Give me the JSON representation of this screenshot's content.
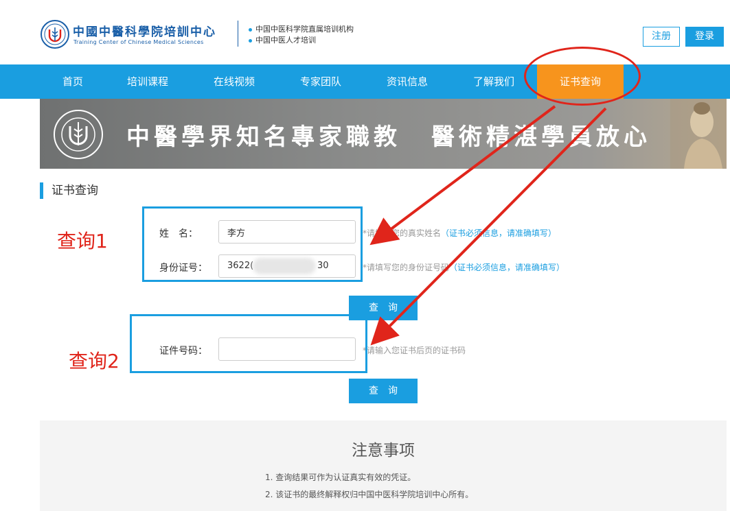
{
  "header": {
    "logo_cn": "中國中醫科學院培訓中心",
    "logo_en": "Training Center of Chinese Medical Sciences",
    "taglines": [
      "中国中医科学院直属培训机构",
      "中国中医人才培训"
    ],
    "register_label": "注册",
    "login_label": "登录"
  },
  "nav": {
    "items": [
      {
        "label": "首页"
      },
      {
        "label": "培训课程"
      },
      {
        "label": "在线视频"
      },
      {
        "label": "专家团队"
      },
      {
        "label": "资讯信息"
      },
      {
        "label": "了解我们"
      },
      {
        "label": "证书查询"
      }
    ],
    "active_index": 6
  },
  "banner": {
    "slogan_1": "中醫學界知名專家職教",
    "slogan_2": "醫術精湛學員放心"
  },
  "page": {
    "section_title": "证书查询"
  },
  "form1": {
    "name_label": "姓　名：",
    "name_value": "李方",
    "name_hint_prefix": "*请填写您的真实姓名",
    "name_hint_em": "（证书必须信息，请准确填写）",
    "id_label": "身份证号：",
    "id_value_prefix": "3622(",
    "id_value_suffix": "30",
    "id_hint_prefix": "*请填写您的身份证号码",
    "id_hint_em": "（证书必须信息，请准确填写）",
    "query_label": "查询"
  },
  "form2": {
    "cert_label": "证件号码：",
    "cert_value": "",
    "cert_hint": "*请输入您证书后页的证书码",
    "query_label": "查询"
  },
  "annotations": {
    "label_1": "查询1",
    "label_2": "查询2"
  },
  "notice": {
    "title": "注意事项",
    "items": [
      "1. 查询结果可作为认证真实有效的凭证。",
      "2. 该证书的最终解释权归中国中医科学院培训中心所有。"
    ]
  },
  "colors": {
    "primary_blue": "#1a9ee0",
    "active_orange": "#f7941d",
    "annotation_red": "#e0251b",
    "logo_blue": "#1a5fa8"
  }
}
